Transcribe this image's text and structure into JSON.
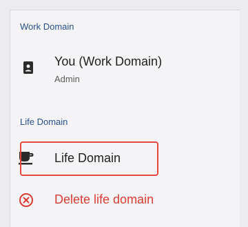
{
  "work_section": {
    "title": "Work Domain",
    "account_name": "You (Work Domain)",
    "account_role": "Admin",
    "icon": "badge-icon"
  },
  "life_section": {
    "title": "Life Domain",
    "account_name": "Life Domain",
    "icon": "coffee-cup-icon"
  },
  "delete_action": {
    "label": "Delete life domain",
    "icon": "close-circle-icon",
    "color": "#d93b33"
  },
  "colors": {
    "section_title": "#294f8a",
    "highlight": "#e4463f"
  }
}
